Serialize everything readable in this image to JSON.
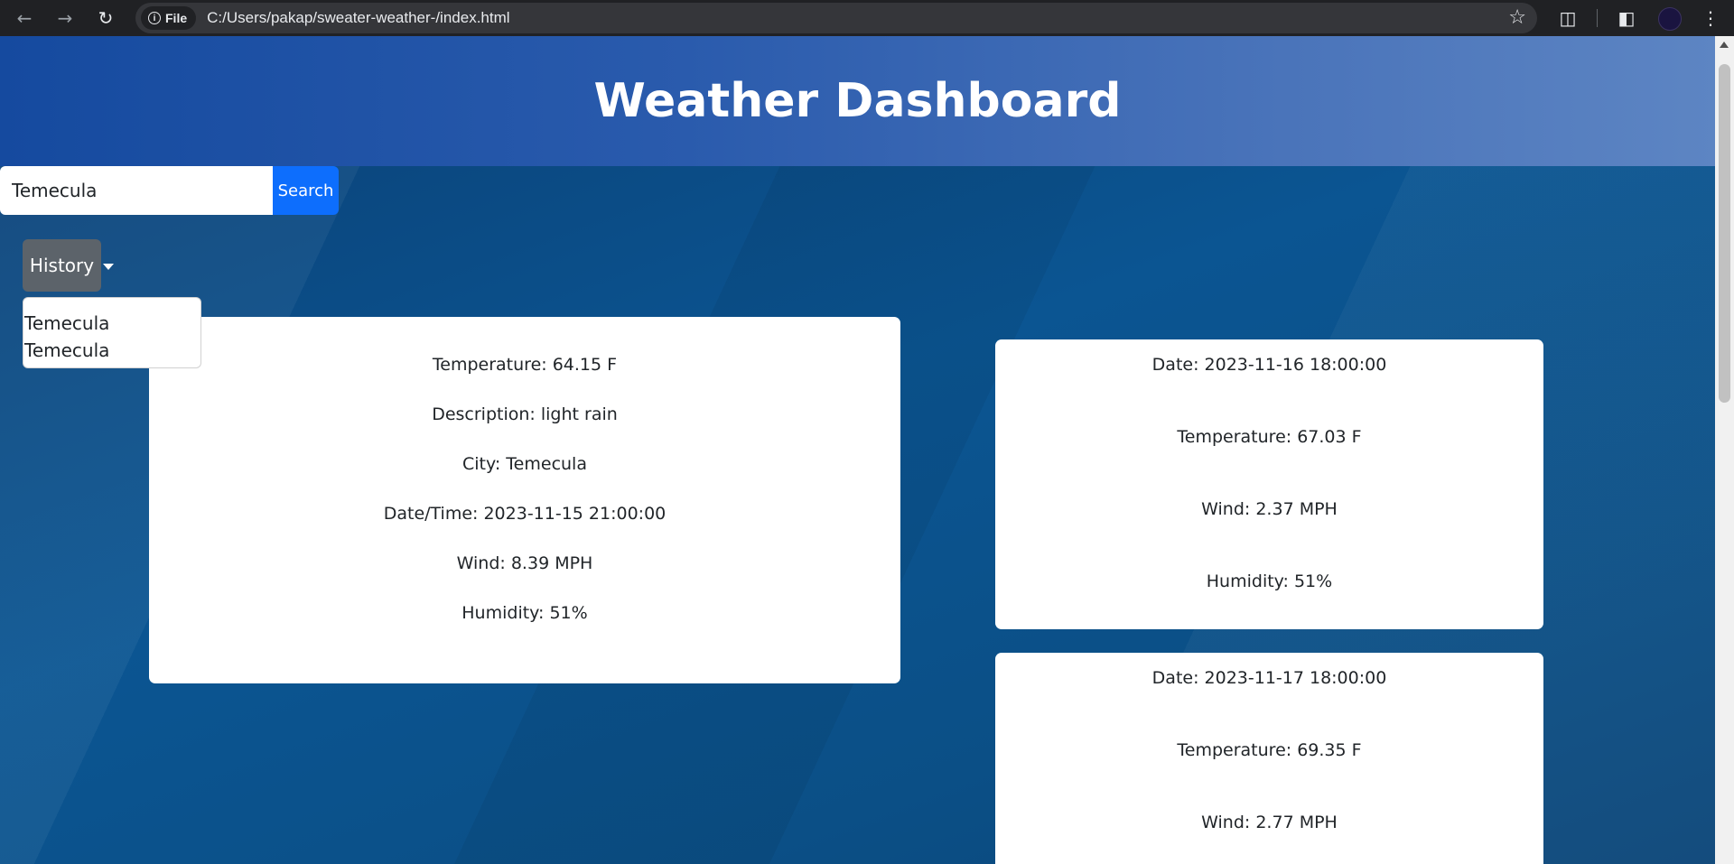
{
  "browser": {
    "back_icon": "arrow-left-icon",
    "forward_icon": "arrow-right-icon",
    "reload_icon": "reload-icon",
    "file_label": "File",
    "url": "C:/Users/pakap/sweater-weather-/index.html"
  },
  "header": {
    "title": "Weather Dashboard"
  },
  "search": {
    "value": "Temecula",
    "button_label": "Search"
  },
  "history": {
    "button_label": "History",
    "items": [
      "Temecula",
      "Temecula"
    ]
  },
  "current": {
    "temperature": "Temperature: 64.15 F",
    "description": "Description: light rain",
    "city": "City: Temecula",
    "datetime": "Date/Time: 2023-11-15 21:00:00",
    "wind": "Wind: 8.39 MPH",
    "humidity": "Humidity: 51%"
  },
  "forecast": [
    {
      "date": "Date: 2023-11-16 18:00:00",
      "temperature": "Temperature: 67.03 F",
      "wind": "Wind: 2.37 MPH",
      "humidity": "Humidity: 51%"
    },
    {
      "date": "Date: 2023-11-17 18:00:00",
      "temperature": "Temperature: 69.35 F",
      "wind": "Wind: 2.77 MPH"
    }
  ]
}
